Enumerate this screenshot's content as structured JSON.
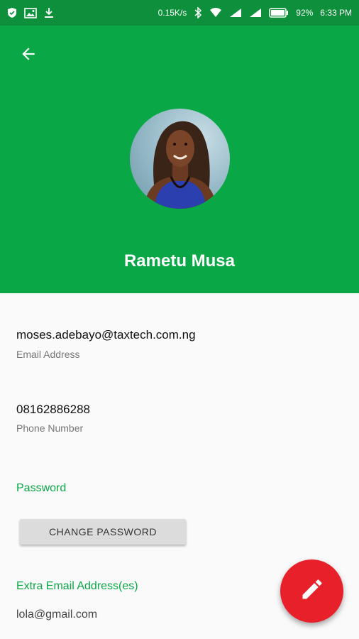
{
  "status_bar": {
    "network_speed": "0.15K/s",
    "battery": "92%",
    "time": "6:33 PM",
    "icons": [
      "shield-icon",
      "image-icon",
      "download-icon",
      "bluetooth-icon",
      "wifi-icon",
      "signal-icon",
      "signal-icon",
      "battery-icon"
    ]
  },
  "header": {
    "back_icon": "arrow-left-icon",
    "name": "Rametu Musa",
    "colors": {
      "header_bg": "#0aa747",
      "status_bg": "#0d8f3c"
    }
  },
  "fields": {
    "email": {
      "value": "moses.adebayo@taxtech.com.ng",
      "label": "Email Address"
    },
    "phone": {
      "value": "08162886288",
      "label": "Phone Number"
    }
  },
  "password_section": {
    "title": "Password",
    "button_label": "CHANGE PASSWORD"
  },
  "extra_email_section": {
    "title": "Extra Email Address(es)",
    "items": [
      "lola@gmail.com"
    ]
  },
  "fab": {
    "icon": "pencil-icon",
    "color": "#e8202a"
  }
}
